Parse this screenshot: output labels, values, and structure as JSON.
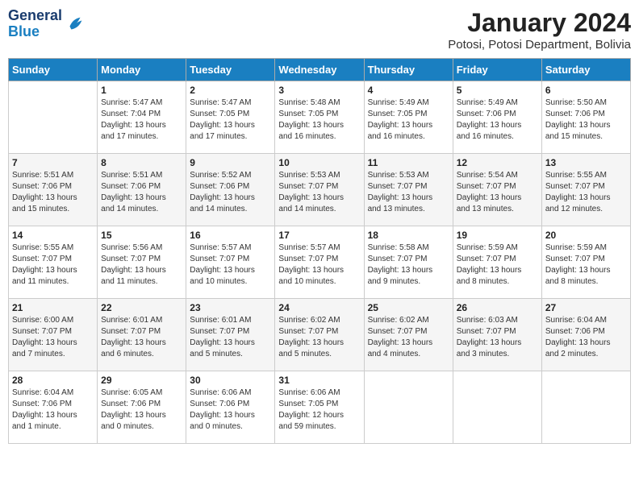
{
  "header": {
    "logo_line1": "General",
    "logo_line2": "Blue",
    "month": "January 2024",
    "location": "Potosi, Potosi Department, Bolivia"
  },
  "days_of_week": [
    "Sunday",
    "Monday",
    "Tuesday",
    "Wednesday",
    "Thursday",
    "Friday",
    "Saturday"
  ],
  "weeks": [
    [
      {
        "num": "",
        "text": ""
      },
      {
        "num": "1",
        "text": "Sunrise: 5:47 AM\nSunset: 7:04 PM\nDaylight: 13 hours\nand 17 minutes."
      },
      {
        "num": "2",
        "text": "Sunrise: 5:47 AM\nSunset: 7:05 PM\nDaylight: 13 hours\nand 17 minutes."
      },
      {
        "num": "3",
        "text": "Sunrise: 5:48 AM\nSunset: 7:05 PM\nDaylight: 13 hours\nand 16 minutes."
      },
      {
        "num": "4",
        "text": "Sunrise: 5:49 AM\nSunset: 7:05 PM\nDaylight: 13 hours\nand 16 minutes."
      },
      {
        "num": "5",
        "text": "Sunrise: 5:49 AM\nSunset: 7:06 PM\nDaylight: 13 hours\nand 16 minutes."
      },
      {
        "num": "6",
        "text": "Sunrise: 5:50 AM\nSunset: 7:06 PM\nDaylight: 13 hours\nand 15 minutes."
      }
    ],
    [
      {
        "num": "7",
        "text": "Sunrise: 5:51 AM\nSunset: 7:06 PM\nDaylight: 13 hours\nand 15 minutes."
      },
      {
        "num": "8",
        "text": "Sunrise: 5:51 AM\nSunset: 7:06 PM\nDaylight: 13 hours\nand 14 minutes."
      },
      {
        "num": "9",
        "text": "Sunrise: 5:52 AM\nSunset: 7:06 PM\nDaylight: 13 hours\nand 14 minutes."
      },
      {
        "num": "10",
        "text": "Sunrise: 5:53 AM\nSunset: 7:07 PM\nDaylight: 13 hours\nand 14 minutes."
      },
      {
        "num": "11",
        "text": "Sunrise: 5:53 AM\nSunset: 7:07 PM\nDaylight: 13 hours\nand 13 minutes."
      },
      {
        "num": "12",
        "text": "Sunrise: 5:54 AM\nSunset: 7:07 PM\nDaylight: 13 hours\nand 13 minutes."
      },
      {
        "num": "13",
        "text": "Sunrise: 5:55 AM\nSunset: 7:07 PM\nDaylight: 13 hours\nand 12 minutes."
      }
    ],
    [
      {
        "num": "14",
        "text": "Sunrise: 5:55 AM\nSunset: 7:07 PM\nDaylight: 13 hours\nand 11 minutes."
      },
      {
        "num": "15",
        "text": "Sunrise: 5:56 AM\nSunset: 7:07 PM\nDaylight: 13 hours\nand 11 minutes."
      },
      {
        "num": "16",
        "text": "Sunrise: 5:57 AM\nSunset: 7:07 PM\nDaylight: 13 hours\nand 10 minutes."
      },
      {
        "num": "17",
        "text": "Sunrise: 5:57 AM\nSunset: 7:07 PM\nDaylight: 13 hours\nand 10 minutes."
      },
      {
        "num": "18",
        "text": "Sunrise: 5:58 AM\nSunset: 7:07 PM\nDaylight: 13 hours\nand 9 minutes."
      },
      {
        "num": "19",
        "text": "Sunrise: 5:59 AM\nSunset: 7:07 PM\nDaylight: 13 hours\nand 8 minutes."
      },
      {
        "num": "20",
        "text": "Sunrise: 5:59 AM\nSunset: 7:07 PM\nDaylight: 13 hours\nand 8 minutes."
      }
    ],
    [
      {
        "num": "21",
        "text": "Sunrise: 6:00 AM\nSunset: 7:07 PM\nDaylight: 13 hours\nand 7 minutes."
      },
      {
        "num": "22",
        "text": "Sunrise: 6:01 AM\nSunset: 7:07 PM\nDaylight: 13 hours\nand 6 minutes."
      },
      {
        "num": "23",
        "text": "Sunrise: 6:01 AM\nSunset: 7:07 PM\nDaylight: 13 hours\nand 5 minutes."
      },
      {
        "num": "24",
        "text": "Sunrise: 6:02 AM\nSunset: 7:07 PM\nDaylight: 13 hours\nand 5 minutes."
      },
      {
        "num": "25",
        "text": "Sunrise: 6:02 AM\nSunset: 7:07 PM\nDaylight: 13 hours\nand 4 minutes."
      },
      {
        "num": "26",
        "text": "Sunrise: 6:03 AM\nSunset: 7:07 PM\nDaylight: 13 hours\nand 3 minutes."
      },
      {
        "num": "27",
        "text": "Sunrise: 6:04 AM\nSunset: 7:06 PM\nDaylight: 13 hours\nand 2 minutes."
      }
    ],
    [
      {
        "num": "28",
        "text": "Sunrise: 6:04 AM\nSunset: 7:06 PM\nDaylight: 13 hours\nand 1 minute."
      },
      {
        "num": "29",
        "text": "Sunrise: 6:05 AM\nSunset: 7:06 PM\nDaylight: 13 hours\nand 0 minutes."
      },
      {
        "num": "30",
        "text": "Sunrise: 6:06 AM\nSunset: 7:06 PM\nDaylight: 13 hours\nand 0 minutes."
      },
      {
        "num": "31",
        "text": "Sunrise: 6:06 AM\nSunset: 7:05 PM\nDaylight: 12 hours\nand 59 minutes."
      },
      {
        "num": "",
        "text": ""
      },
      {
        "num": "",
        "text": ""
      },
      {
        "num": "",
        "text": ""
      }
    ]
  ]
}
